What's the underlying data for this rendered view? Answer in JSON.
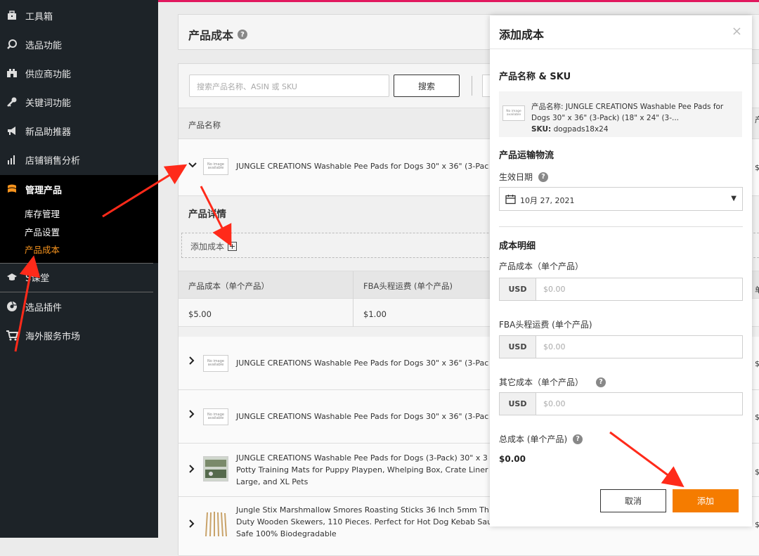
{
  "sidebar": {
    "items": [
      {
        "label": "工具箱",
        "icon": "toolbox-icon"
      },
      {
        "label": "选品功能",
        "icon": "search-icon"
      },
      {
        "label": "供应商功能",
        "icon": "supplier-icon"
      },
      {
        "label": "关键词功能",
        "icon": "key-icon"
      },
      {
        "label": "新品助推器",
        "icon": "megaphone-icon"
      },
      {
        "label": "店铺销售分析",
        "icon": "bar-chart-icon"
      },
      {
        "label": "管理产品",
        "icon": "manage-products-icon"
      },
      {
        "label": "S课堂",
        "icon": "graduation-cap-icon"
      },
      {
        "label": "选品插件",
        "icon": "plugin-icon"
      },
      {
        "label": "海外服务市场",
        "icon": "cart-icon"
      }
    ],
    "subitems": [
      "库存管理",
      "产品设置",
      "产品成本"
    ],
    "accent_color": "#f7941e"
  },
  "header": {
    "title": "产品成本",
    "help": "?"
  },
  "search": {
    "placeholder": "搜索产品名称、ASIN 或 SKU",
    "button": "搜索"
  },
  "table": {
    "column_product_name": "产品名称",
    "rows": [
      {
        "title": "JUNGLE CREATIONS Washable Pee Pads for Dogs 30\" x 36\" (3-Pac"
      },
      {
        "title": "JUNGLE CREATIONS Washable Pee Pads for Dogs 30\" x 36\" (3-Pac"
      },
      {
        "title": "JUNGLE CREATIONS Washable Pee Pads for Dogs 30\" x 36\" (3-Pac"
      },
      {
        "title_lines": [
          "JUNGLE CREATIONS Washable Pee Pads for Dogs (3-Pack) 30\" x 3",
          "Potty Training Mats for Puppy Playpen, Whelping Box, Crate Liner",
          "Large, and XL Pets"
        ]
      },
      {
        "title_lines": [
          "Jungle Stix Marshmallow Smores Roasting Sticks 36 Inch 5mm Th",
          "Duty Wooden Skewers, 110 Pieces. Perfect for Hot Dog Kebab Saus",
          "Safe 100% Biodegradable"
        ]
      }
    ],
    "thumb_text": "No image available",
    "edge_marks": [
      "产",
      "$",
      "单",
      "$",
      "$",
      "$",
      "$"
    ]
  },
  "detail": {
    "title": "产品详情",
    "add_cost": "添加成本",
    "col_cost": "产品成本（单个产品）",
    "col_fba": "FBA头程运费 (单个产品)",
    "val_cost": "$5.00",
    "val_fba": "$1.00"
  },
  "modal": {
    "title": "添加成本",
    "close": "×",
    "section_product": "产品名称 & SKU",
    "product_name_label": "产品名称:",
    "product_name": "JUNGLE CREATIONS Washable Pee Pads for Dogs 30\" x 36\" (3-Pack) (18\" x 24\" (3-...",
    "sku_label": "SKU:",
    "sku": "dogpads18x24",
    "thumb_text": "No image available",
    "section_logistics": "产品运输物流",
    "effective_date_label": "生效日期",
    "effective_date": "10月 27, 2021",
    "section_cost": "成本明细",
    "product_cost_label": "产品成本（单个产品）",
    "fba_label": "FBA头程运费 (单个产品)",
    "other_cost_label": "其它成本（单个产品）",
    "currency": "USD",
    "amount_placeholder": "$0.00",
    "total_label": "总成本 (单个产品)",
    "total_value": "$0.00",
    "cancel": "取消",
    "add": "添加",
    "add_color": "#f57c00"
  },
  "annotation_color": "#ff2a1a"
}
